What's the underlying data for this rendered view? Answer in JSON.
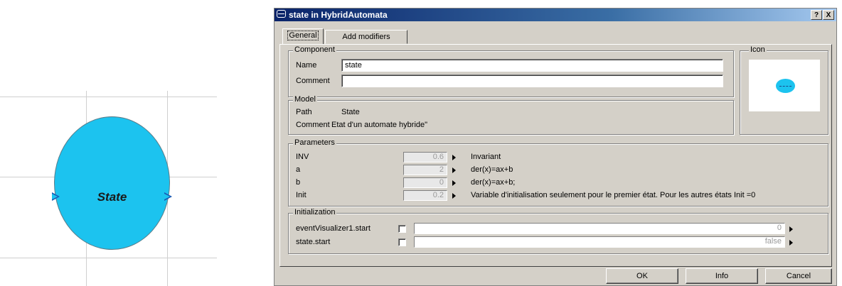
{
  "diagram": {
    "state_label": "State"
  },
  "dialog": {
    "title": "state in HybridAutomata",
    "help_button": "?",
    "close_button": "X",
    "tabs": [
      "General",
      "Add modifiers"
    ],
    "component": {
      "legend": "Component",
      "name_label": "Name",
      "name_value": "state",
      "comment_label": "Comment",
      "comment_value": ""
    },
    "icon_legend": "Icon",
    "model": {
      "legend": "Model",
      "path_label": "Path",
      "path_value": "State",
      "comment_label": "Comment",
      "comment_value": "Etat d'un automate hybride\""
    },
    "parameters": {
      "legend": "Parameters",
      "rows": [
        {
          "name": "INV",
          "value": "0.6",
          "description": "Invariant"
        },
        {
          "name": "a",
          "value": "2",
          "description": "der(x)=ax+b"
        },
        {
          "name": "b",
          "value": "0",
          "description": "der(x)=ax+b;"
        },
        {
          "name": "Init",
          "value": "0.2",
          "description": "Variable d'initialisation seulement pour le premier état. Pour les autres états Init =0"
        }
      ]
    },
    "initialization": {
      "legend": "Initialization",
      "rows": [
        {
          "name": "eventVisualizer1.start",
          "value": "0"
        },
        {
          "name": "state.start",
          "value": "false"
        }
      ]
    },
    "buttons": {
      "ok": "OK",
      "info": "Info",
      "cancel": "Cancel"
    }
  },
  "colors": {
    "state_fill": "#1cc3ef",
    "titlebar": "#0a246a",
    "dialog_bg": "#d4d0c8"
  }
}
